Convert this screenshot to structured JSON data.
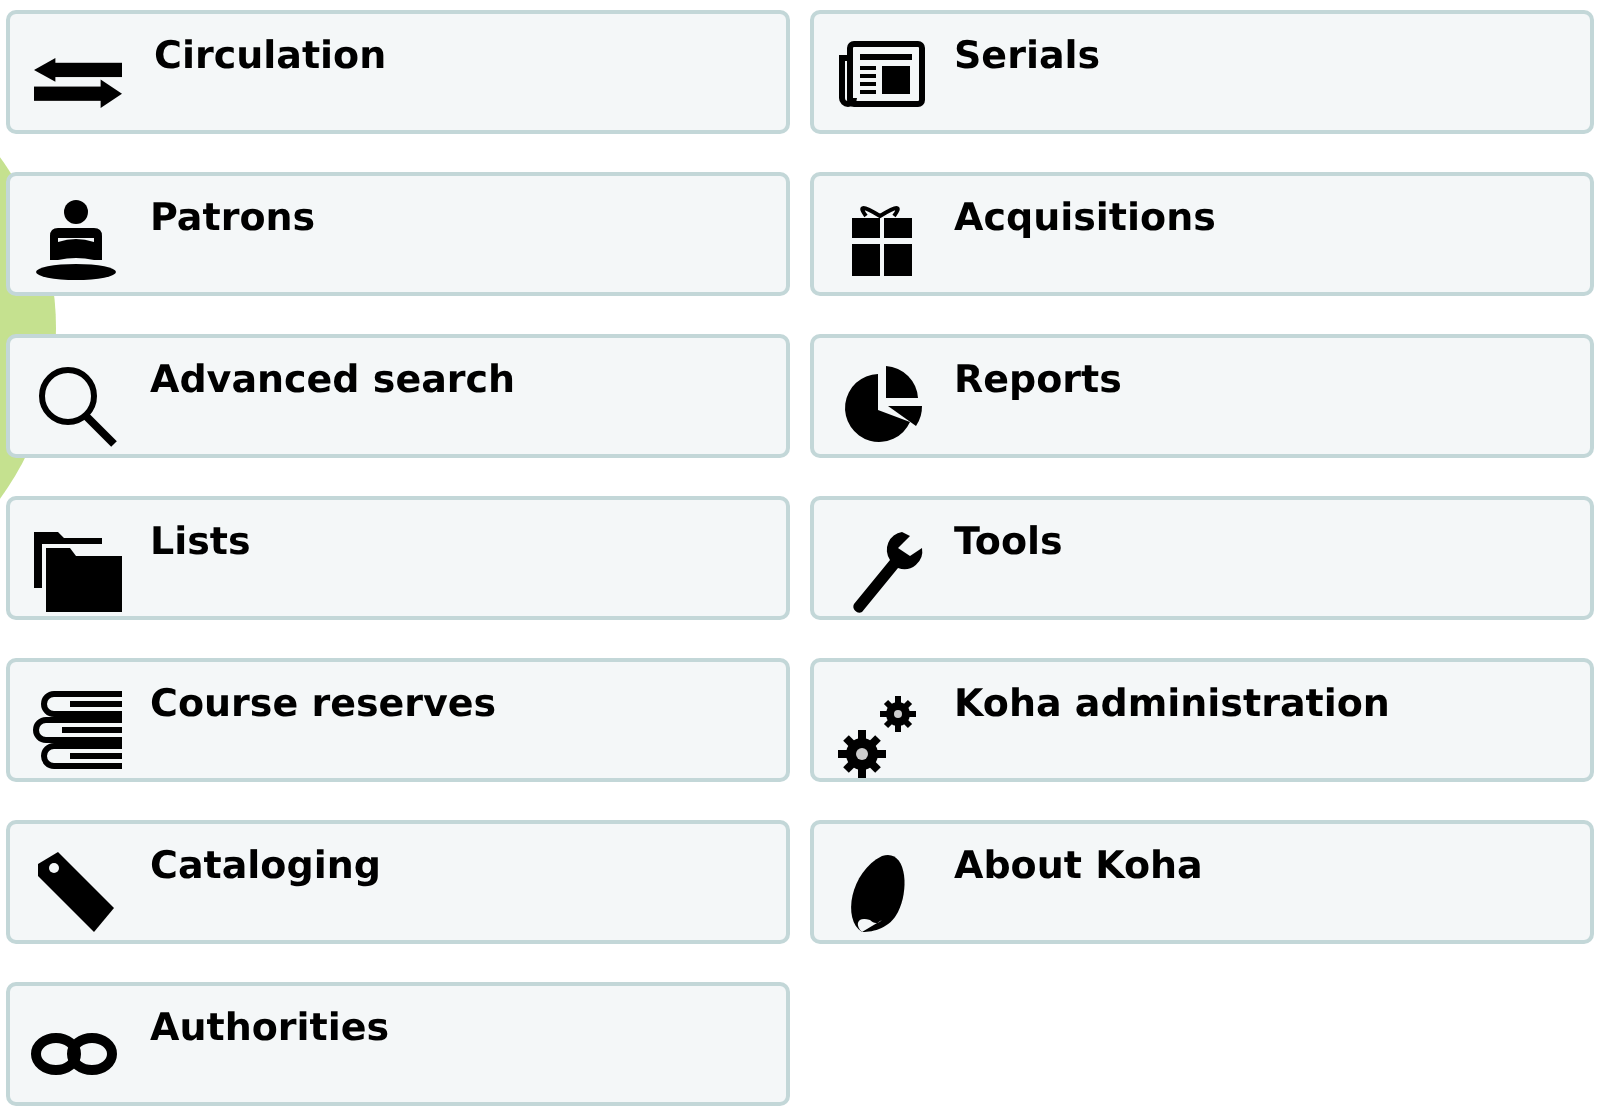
{
  "modules": [
    {
      "label": "Circulation"
    },
    {
      "label": "Serials"
    },
    {
      "label": "Patrons"
    },
    {
      "label": "Acquisitions"
    },
    {
      "label": "Advanced search"
    },
    {
      "label": "Reports"
    },
    {
      "label": "Lists"
    },
    {
      "label": "Tools"
    },
    {
      "label": "Course reserves"
    },
    {
      "label": "Koha administration"
    },
    {
      "label": "Cataloging"
    },
    {
      "label": "About Koha"
    },
    {
      "label": "Authorities"
    }
  ]
}
